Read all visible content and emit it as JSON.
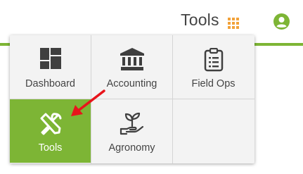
{
  "header": {
    "title": "Tools",
    "apps_icon": "grid-icon",
    "user_icon": "user-circle-icon",
    "accent_color": "#7db535",
    "icon_orange": "#f2a23a"
  },
  "menu": {
    "items": [
      {
        "label": "Dashboard",
        "icon": "dashboard-icon",
        "active": false
      },
      {
        "label": "Accounting",
        "icon": "bank-icon",
        "active": false
      },
      {
        "label": "Field Ops",
        "icon": "clipboard-icon",
        "active": false
      },
      {
        "label": "Tools",
        "icon": "tools-icon",
        "active": true
      },
      {
        "label": "Agronomy",
        "icon": "sprout-hand-icon",
        "active": false
      }
    ]
  },
  "annotation": {
    "arrow_color": "#e8141b"
  }
}
